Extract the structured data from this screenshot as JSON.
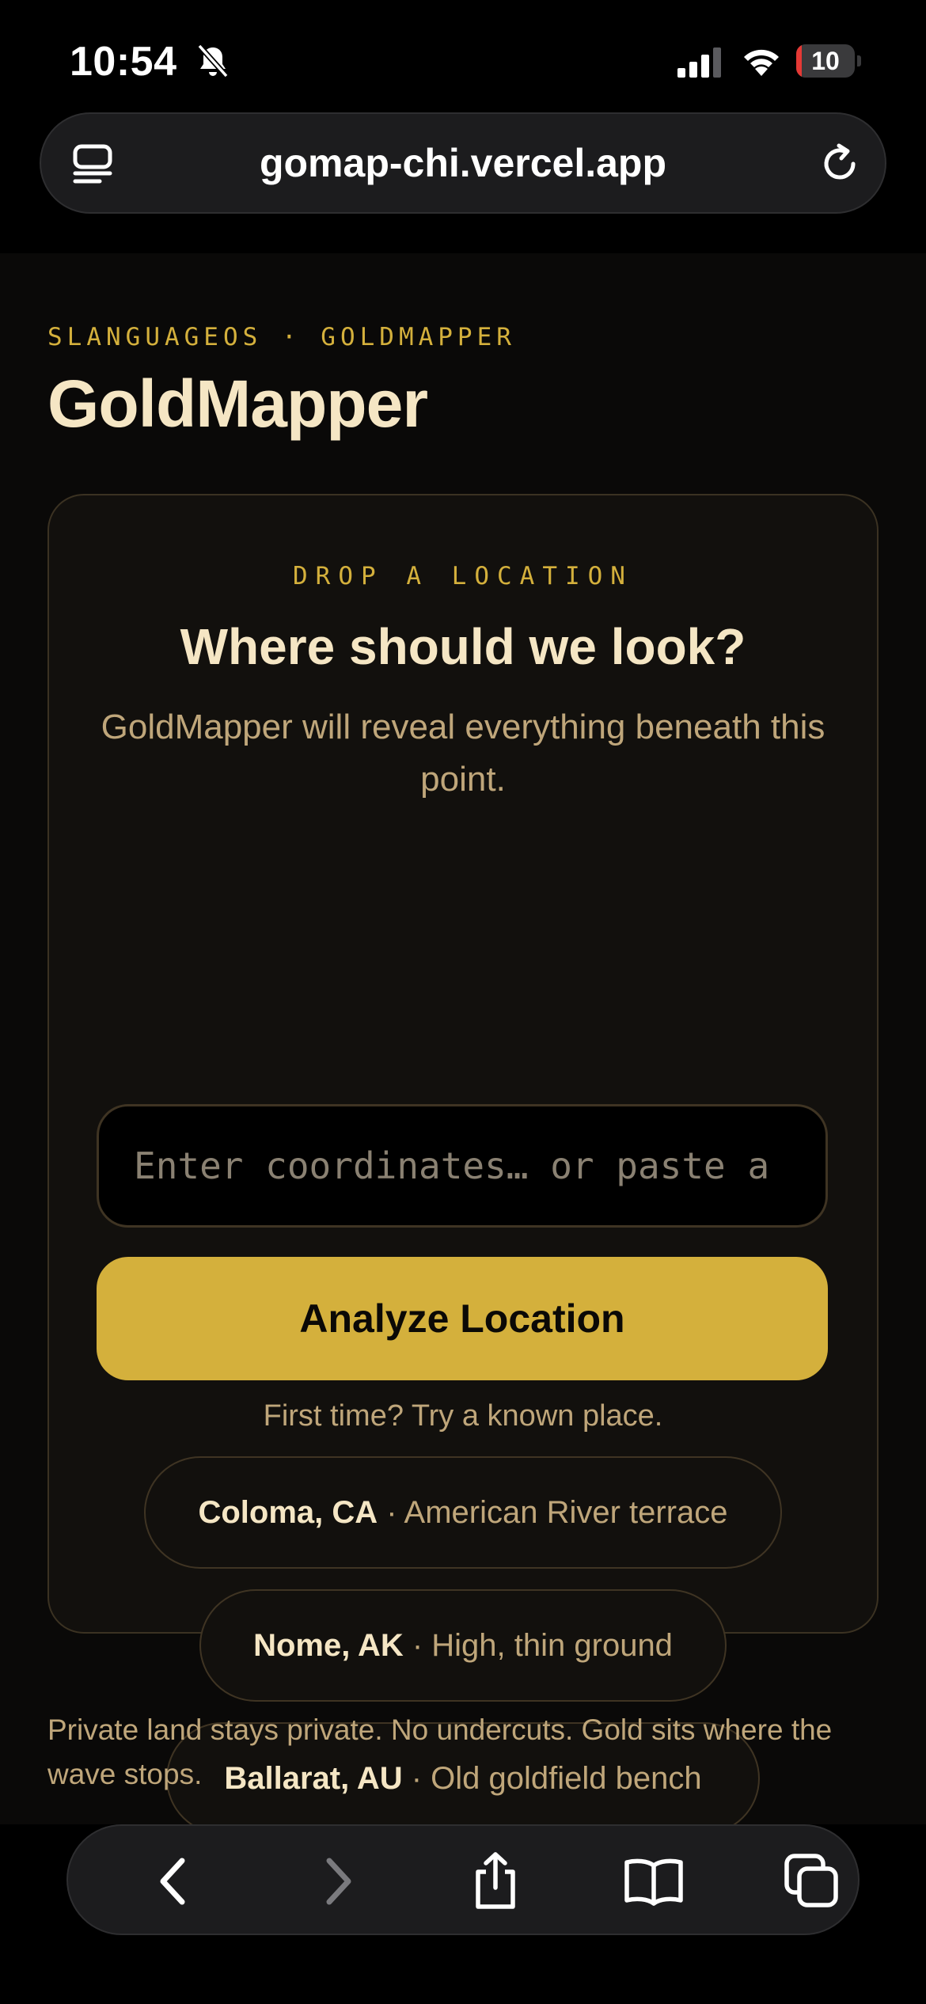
{
  "status_bar": {
    "time": "10:54",
    "battery_level": "10",
    "battery_fraction": 0.1,
    "icons": [
      "bell-slash-icon",
      "cellular-signal-icon",
      "wifi-icon",
      "battery-icon"
    ]
  },
  "browser": {
    "url": "gomap-chi.vercel.app",
    "icons": [
      "tabs-icon",
      "reload-icon"
    ],
    "toolbar_icons": [
      "back-icon",
      "forward-icon",
      "share-icon",
      "bookmarks-icon",
      "tabs-overview-icon"
    ]
  },
  "header": {
    "kicker": "SLANGUAGEOS · GOLDMAPPER",
    "title": "GoldMapper"
  },
  "card": {
    "kicker": "DROP A LOCATION",
    "heading": "Where should we look?",
    "description": "GoldMapper will reveal everything beneath this point.",
    "input": {
      "value": "",
      "placeholder": "Enter coordinates… or paste a link"
    },
    "button_label": "Analyze Location",
    "hint": "First time? Try a known place.",
    "examples": [
      {
        "place": "Coloma, CA",
        "separator": "·",
        "description": "American River terrace"
      },
      {
        "place": "Nome, AK",
        "separator": "·",
        "description": "High, thin ground"
      },
      {
        "place": "Ballarat, AU",
        "separator": "·",
        "description": "Old goldfield bench"
      }
    ]
  },
  "footer": {
    "note": "Private land stays private. No undercuts. Gold sits where the wave stops."
  },
  "colors": {
    "accent_gold": "#d4b03c",
    "text_cream": "#f5e6c4",
    "text_muted": "#bfa67a",
    "card_border": "#3b3222",
    "background": "#0a0908"
  }
}
